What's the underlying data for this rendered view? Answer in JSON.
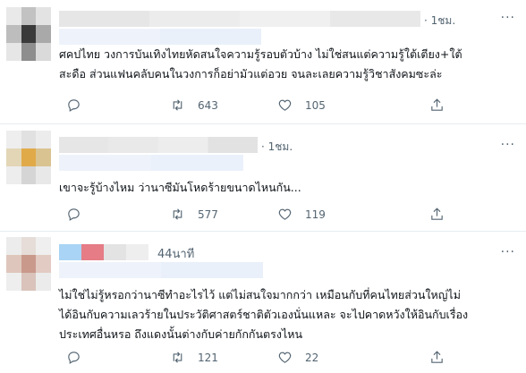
{
  "tweets": [
    {
      "time": "· 1ชม.",
      "text_lines": [
        "ศคปไทย วงการบันเทิงไทยหัดสนใจความรู้รอบตัวบ้าง ไม่ใช่สนแต่ความรู้ใต้เตียง+ใต้",
        "สะดือ ส่วนแฟนคลับคนในวงการก็อย่ามัวแต่อวย จนละเลยความรู้วิชาสังคมซะล่ะ"
      ],
      "retweets": "643",
      "likes": "105",
      "colors": {
        "avatar": [
          "#e9e9e9",
          "#c2c2c2",
          "#e3e3e3",
          "#bdbdbd",
          "#3a3a3a",
          "#a9a9a9",
          "#e6e6e6",
          "#8e8e8e",
          "#dadada"
        ],
        "name": [
          "#e6e6e6",
          "#ececec",
          "#f0f0f0",
          "#e8e8e8"
        ],
        "handle": [
          "#eef3fb",
          "#e9f0fa"
        ]
      }
    },
    {
      "time": "· 1ชม.",
      "text_lines": [
        "เขาจะรู้บ้างไหม ว่านาซีมันโหดร้ายขนาดไหนกัน..."
      ],
      "retweets": "577",
      "likes": "119",
      "colors": {
        "avatar": [
          "#eeeeee",
          "#e1e1e1",
          "#ececec",
          "#e3d6b6",
          "#e1aa49",
          "#d9c390",
          "#ededed",
          "#d5d5d5",
          "#e8e8e8"
        ],
        "name": [
          "#e6e6e6",
          "#e9e9e9",
          "#ededed",
          "#e2e2e2"
        ],
        "handle": [
          "#eef3fb",
          "#eaf1fb"
        ]
      }
    },
    {
      "time": "44นาที",
      "text_lines": [
        "ไม่ใช่ไม่รู้หรอกว่านาซีทำอะไรไว้ แต่ไม่สนใจมากกว่า เหมือนกับที่คนไทยส่วนใหญ่ไม่",
        "ได้อินกับความเลวร้ายในประวัติศาสตร์ชาติตัวเองนั่นแหละ จะไปคาดหวังให้อินกับเรื่อง",
        "ประเทศอื่นหรอ ถึงแดงนั้นต่างกับค่ายกักกันตรงไหน"
      ],
      "retweets": "121",
      "likes": "22",
      "colors": {
        "avatar": [
          "#ececec",
          "#e6dcd8",
          "#efefef",
          "#dfc6bc",
          "#c9998c",
          "#e2cbc3",
          "#eeeeee",
          "#d9c3bb",
          "#ebebeb"
        ],
        "name": [
          "#a9d4f5",
          "#e57c86",
          "#e3e3e3",
          "#eeeeee"
        ],
        "handle": [
          "#eef3fb",
          "#e9f0fa"
        ]
      }
    }
  ]
}
